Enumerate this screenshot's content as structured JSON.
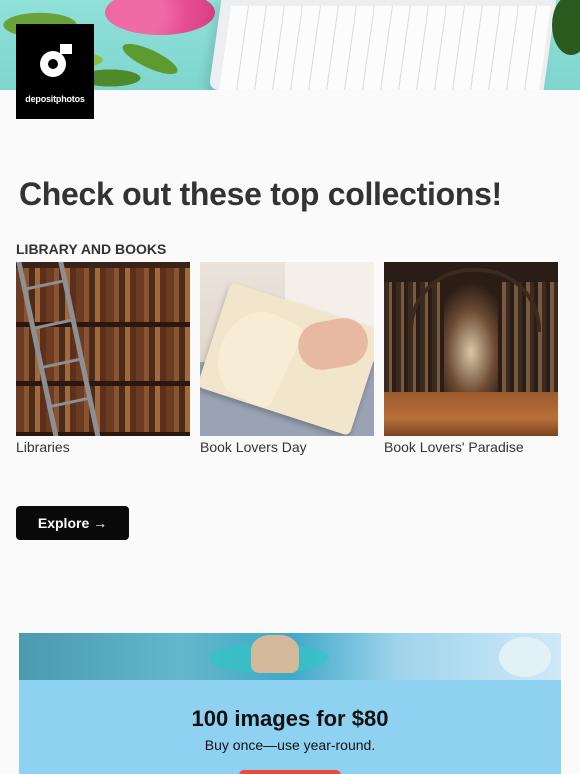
{
  "brand": {
    "name": "depositphotos"
  },
  "headline": "Check out these top collections!",
  "section": {
    "label": "LIBRARY AND BOOKS",
    "collections": [
      {
        "caption": "Libraries"
      },
      {
        "caption": "Book Lovers Day"
      },
      {
        "caption": "Book Lovers' Paradise"
      }
    ]
  },
  "explore_button": {
    "label": "Explore →"
  },
  "promo": {
    "title": "100 images for $80",
    "subtitle": "Buy once—use year-round."
  },
  "colors": {
    "button_bg": "#0a0a0a",
    "promo_bg": "#8fd1f0",
    "promo_cta": "#e94b3c",
    "text": "#333333"
  }
}
